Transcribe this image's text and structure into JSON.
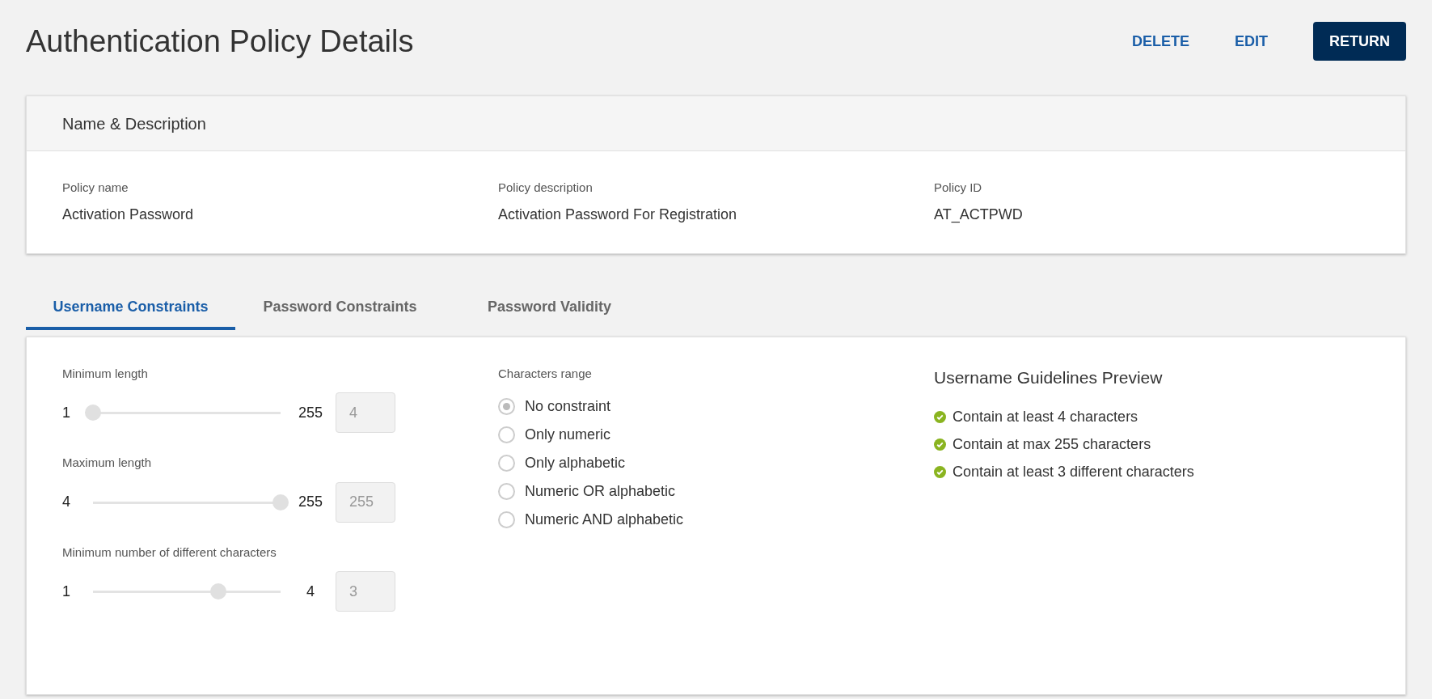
{
  "page": {
    "title": "Authentication Policy Details",
    "actions": [
      {
        "label": "DELETE",
        "kind": "text"
      },
      {
        "label": "EDIT",
        "kind": "text"
      },
      {
        "label": "RETURN",
        "kind": "primary"
      }
    ]
  },
  "details_card": {
    "title": "Name & Description",
    "fields": [
      {
        "label": "Policy name",
        "value": "Activation Password"
      },
      {
        "label": "Policy description",
        "value": "Activation Password For Registration"
      },
      {
        "label": "Policy ID",
        "value": "AT_ACTPWD"
      }
    ]
  },
  "tabs": [
    {
      "label": "Username Constraints",
      "selected": true
    },
    {
      "label": "Password Constraints",
      "selected": false
    },
    {
      "label": "Password Validity",
      "selected": false
    }
  ],
  "sliders": [
    {
      "label": "Minimum length",
      "min": "1",
      "max": "255",
      "level": 0.0,
      "value": "4",
      "disabled": true
    },
    {
      "label": "Maximum length",
      "min": "4",
      "max": "255",
      "level": 1.0,
      "value": "255",
      "disabled": true
    },
    {
      "label": "Minimum number of different characters",
      "min": "1",
      "max": "4",
      "level": 0.67,
      "value": "3",
      "disabled": true
    }
  ],
  "characters_range": {
    "label": "Characters range",
    "options": [
      {
        "label": "No constraint",
        "selected": true
      },
      {
        "label": "Only numeric",
        "selected": false
      },
      {
        "label": "Only alphabetic",
        "selected": false
      },
      {
        "label": "Numeric OR alphabetic",
        "selected": false
      },
      {
        "label": "Numeric AND alphabetic",
        "selected": false
      }
    ]
  },
  "preview": {
    "title": "Username Guidelines Preview",
    "items": [
      {
        "text": "Contain at least 4 characters",
        "checked": true
      },
      {
        "text": "Contain at max 255 characters",
        "checked": true
      },
      {
        "text": "Contain at least 3 different characters",
        "checked": true
      }
    ]
  }
}
